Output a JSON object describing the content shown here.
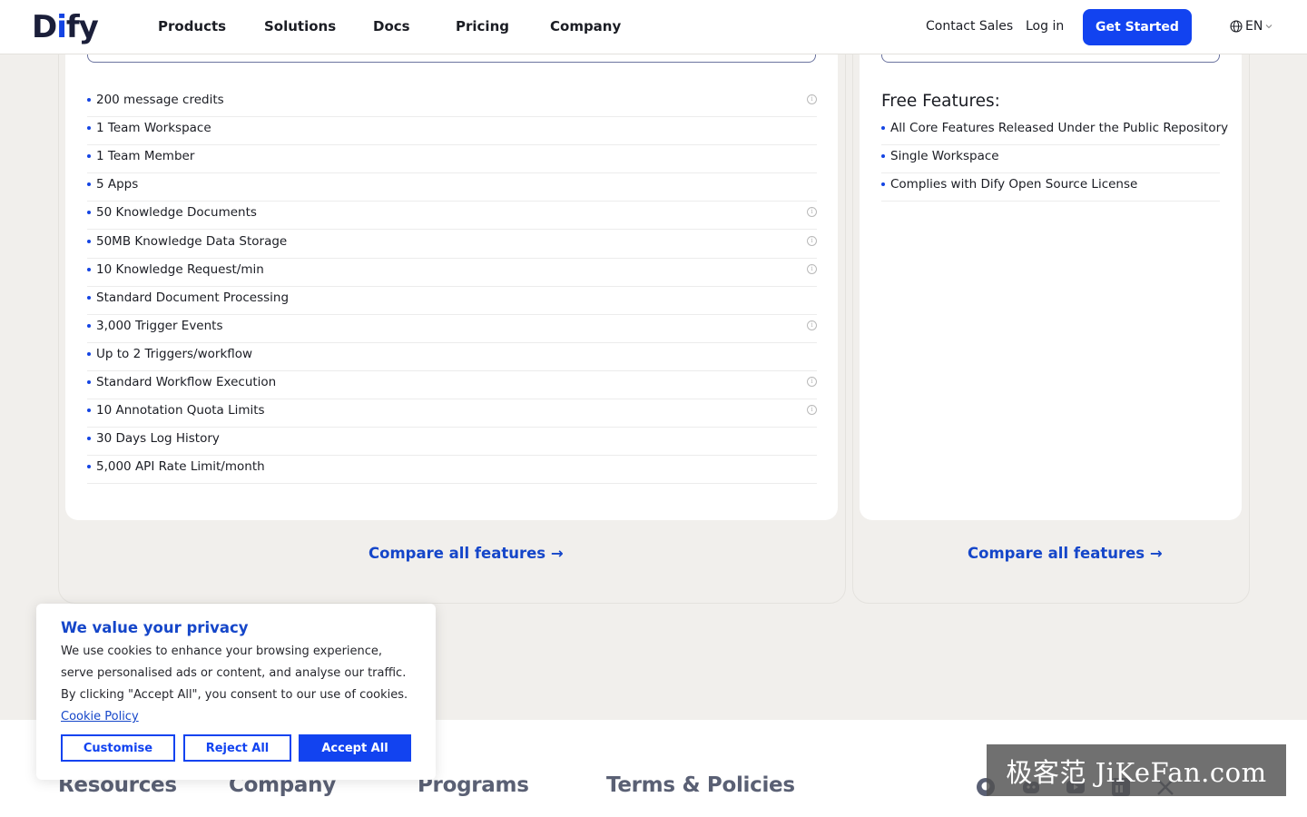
{
  "header": {
    "logo": "Dify",
    "nav": [
      "Products",
      "Solutions",
      "Docs",
      "Pricing",
      "Company"
    ],
    "contact_sales": "Contact Sales",
    "login": "Log in",
    "get_started": "Get Started",
    "language": "EN"
  },
  "plan_left": {
    "features": [
      {
        "text": "200 message credits",
        "info": true
      },
      {
        "text": "1 Team Workspace",
        "info": false
      },
      {
        "text": "1 Team Member",
        "info": false
      },
      {
        "text": "5 Apps",
        "info": false
      },
      {
        "text": "50 Knowledge Documents",
        "info": true
      },
      {
        "text": "50MB Knowledge Data Storage",
        "info": true
      },
      {
        "text": "10 Knowledge Request/min",
        "info": true
      },
      {
        "text": "Standard Document Processing",
        "info": false
      },
      {
        "text": "3,000 Trigger Events",
        "info": true
      },
      {
        "text": "Up to 2 Triggers/workflow",
        "info": false
      },
      {
        "text": "Standard Workflow Execution",
        "info": true
      },
      {
        "text": "10 Annotation Quota Limits",
        "info": true
      },
      {
        "text": "30 Days Log History",
        "info": false
      },
      {
        "text": "5,000 API Rate Limit/month",
        "info": false
      }
    ],
    "compare": "Compare all features →"
  },
  "plan_right": {
    "title": "Free Features:",
    "features": [
      "All Core Features Released Under the Public Repository",
      "Single Workspace",
      "Complies with Dify Open Source License"
    ],
    "compare": "Compare all features →"
  },
  "footer": {
    "columns": [
      "Resources",
      "Company",
      "Programs",
      "Terms & Policies"
    ],
    "social": [
      "github-icon",
      "discord-icon",
      "youtube-icon",
      "linkedin-icon",
      "x-icon"
    ],
    "watermark": "极客范 JiKeFan.com"
  },
  "cookie": {
    "title": "We value your privacy",
    "body": "We use cookies to enhance your browsing experience, serve personalised ads or content, and analyse our traffic. By clicking \"Accept All\", you consent to our use of cookies.",
    "policy_link": "Cookie Policy",
    "customise": "Customise",
    "reject": "Reject All",
    "accept": "Accept All"
  },
  "colors": {
    "brand_blue": "#1243f0",
    "link_blue": "#1546c9",
    "page_bg": "#f1efec"
  }
}
